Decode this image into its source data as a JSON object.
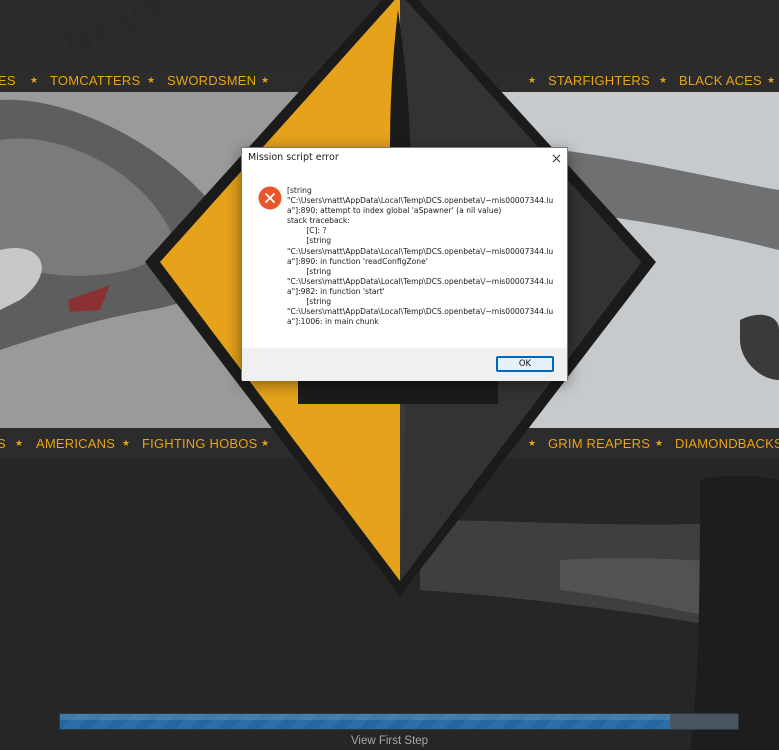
{
  "background": {
    "watermark": "NAVY",
    "top_banner": {
      "left": [
        "ES",
        "TOMCATTERS",
        "SWORDSMEN"
      ],
      "right": [
        "STARFIGHTERS",
        "BLACK ACES"
      ]
    },
    "bottom_banner": {
      "left": [
        "S",
        "AMERICANS",
        "FIGHTING HOBOS"
      ],
      "right": [
        "GRIM REAPERS",
        "DIAMONDBACKS"
      ]
    },
    "accent_color": "#e8a317"
  },
  "dialog": {
    "title": "Mission script error",
    "icon": "error-icon",
    "message": "[string\n\"C:\\Users\\matt\\AppData\\Local\\Temp\\DCS.openbeta\\/~mis00007344.lu\na\"]:890: attempt to index global 'aSpawner' (a nil value)\nstack traceback:\n\t[C]: ?\n\t[string\n\"C:\\Users\\matt\\AppData\\Local\\Temp\\DCS.openbeta\\/~mis00007344.lu\na\"]:890: in function 'readConfigZone'\n\t[string\n\"C:\\Users\\matt\\AppData\\Local\\Temp\\DCS.openbeta\\/~mis00007344.lu\na\"]:982: in function 'start'\n\t[string\n\"C:\\Users\\matt\\AppData\\Local\\Temp\\DCS.openbeta\\/~mis00007344.lu\na\"]:1006: in main chunk",
    "ok_label": "OK"
  },
  "loading": {
    "progress": 0.9,
    "status": "View First Step"
  }
}
